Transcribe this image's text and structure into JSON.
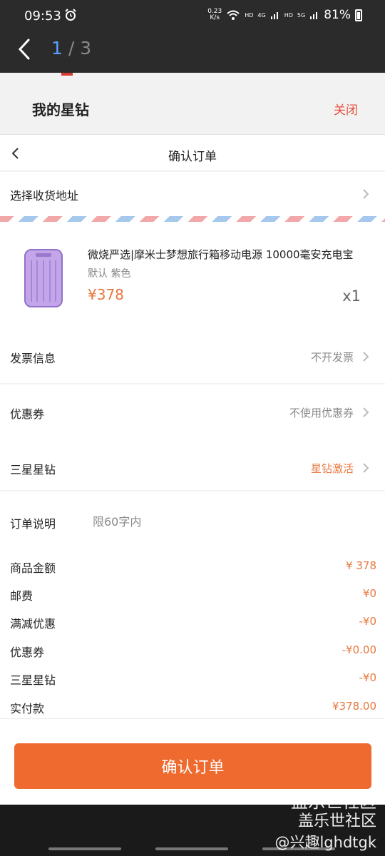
{
  "viewer": {
    "time": "09:53",
    "net_speed_value": "0.23",
    "net_speed_unit": "K/s",
    "network_tags": [
      "HD",
      "4G",
      "HD",
      "5G"
    ],
    "battery": "81%",
    "page_current": "1",
    "page_sep": " / ",
    "page_total": "3"
  },
  "header": {
    "title": "我的星钻",
    "close_label": "关闭"
  },
  "nav": {
    "title": "确认订单"
  },
  "address": {
    "label": "选择收货地址"
  },
  "product": {
    "name": "微烧严选|摩米士梦想旅行箱移动电源 10000毫安充电宝",
    "spec": "默认 紫色",
    "price": "¥378",
    "qty": "x1",
    "image_color": "#b99be0"
  },
  "options": [
    {
      "label": "发票信息",
      "value": "不开发票"
    },
    {
      "label": "优惠券",
      "value": "不使用优惠券"
    },
    {
      "label": "三星星钻",
      "value": "星钻激活"
    }
  ],
  "note": {
    "label": "订单说明",
    "placeholder": "限60字内"
  },
  "summary": [
    {
      "label": "商品金额",
      "value": "¥ 378"
    },
    {
      "label": "邮费",
      "value": "¥0"
    },
    {
      "label": "满减优惠",
      "value": "-¥0"
    },
    {
      "label": "优惠券",
      "value": "-¥0.00"
    },
    {
      "label": "三星星钻",
      "value": "-¥0"
    },
    {
      "label": "实付款",
      "value": "¥378.00"
    }
  ],
  "confirm_button": "确认订单",
  "watermark": {
    "line1": "盖乐世社区",
    "line2": "盖乐世社区",
    "line3": "@兴趣lghdtgk"
  },
  "colors": {
    "accent": "#ee6a2e",
    "price": "#e8773e",
    "close": "#e8503e",
    "page_current": "#5aa0ff"
  }
}
